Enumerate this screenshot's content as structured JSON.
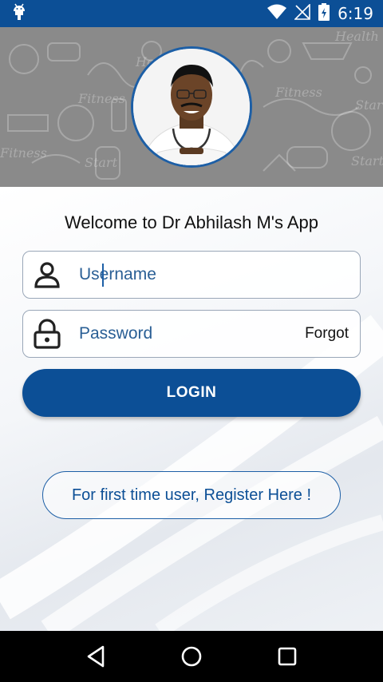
{
  "status_bar": {
    "time": "6:19",
    "icons": [
      "android-debug-icon",
      "wifi-icon",
      "no-signal-icon",
      "battery-icon"
    ]
  },
  "header": {
    "doodle_words": [
      "Health",
      "Fitness",
      "Fitness",
      "Start",
      "Fitness",
      "Start",
      "Health",
      "Start"
    ],
    "avatar_name": "avatar"
  },
  "welcome": "Welcome to Dr Abhilash M's App",
  "login": {
    "username_placeholder": "Username",
    "password_placeholder": "Password",
    "forgot_label": "Forgot",
    "login_label": "LOGIN",
    "register_label": "For first time user, Register Here !"
  },
  "nav": {
    "icons": [
      "back-icon",
      "home-icon",
      "recents-icon"
    ]
  },
  "colors": {
    "brand": "#0c4f96",
    "status_bar": "#0c4f96",
    "header_bg": "#8a8a8a"
  }
}
